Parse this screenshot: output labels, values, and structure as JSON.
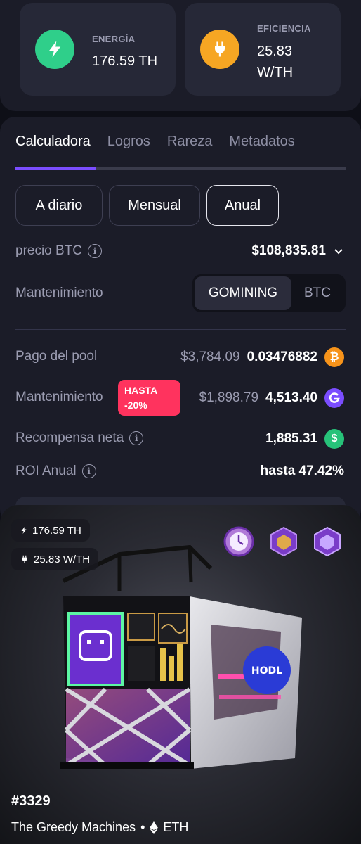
{
  "stats": {
    "energy": {
      "label": "ENERGÍA",
      "value": "176.59 TH",
      "icon": "bolt-icon",
      "color": "#2fcf8a"
    },
    "efficiency": {
      "label": "EFICIENCIA",
      "value_line1": "25.83",
      "value_line2": "W/TH",
      "icon": "plug-icon",
      "color": "#f6a623"
    }
  },
  "tabs": [
    "Calculadora",
    "Logros",
    "Rareza",
    "Metadatos"
  ],
  "active_tab": "Calculadora",
  "periods": [
    "A diario",
    "Mensual",
    "Anual"
  ],
  "active_period": "Anual",
  "btc_price": {
    "label": "precio BTC",
    "value": "$108,835.81"
  },
  "maintenance_toggle": {
    "label": "Mantenimiento",
    "options": [
      "GOMINING",
      "BTC"
    ],
    "selected": "GOMINING"
  },
  "rows": {
    "pool_payout": {
      "label": "Pago del pool",
      "usd": "$3,784.09",
      "amount": "0.03476882",
      "coin": "btc-coin-icon"
    },
    "maintenance": {
      "label": "Mantenimiento",
      "badge_line1": "HASTA",
      "badge_line2": "-20%",
      "usd": "$1,898.79",
      "amount": "4,513.40",
      "coin": "gomining-coin-icon"
    },
    "net_reward": {
      "label": "Recompensa neta",
      "amount": "1,885.31",
      "coin": "dollar-coin-icon"
    },
    "roi": {
      "label": "ROI Anual",
      "value": "hasta 47.42%"
    }
  },
  "nft": {
    "hashrate": "176.59 TH",
    "efficiency": "25.83 W/TH",
    "id": "#3329",
    "collection": "The Greedy Machines",
    "separator": "•",
    "chain": "ETH",
    "badges": [
      "clock-badge-icon",
      "cube-badge-icon",
      "cube-badge-icon"
    ]
  }
}
